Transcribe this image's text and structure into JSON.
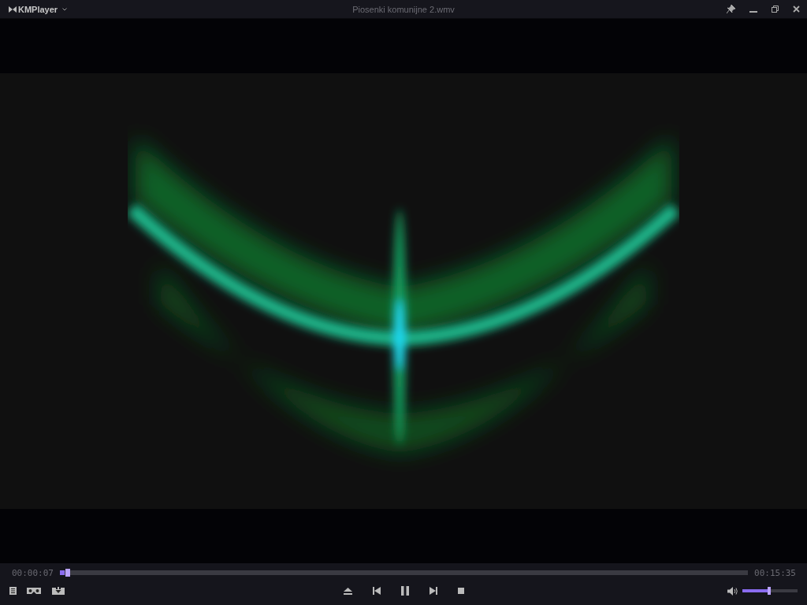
{
  "title_bar": {
    "app_name": "KMPlayer",
    "file_title": "Piosenki komunijne 2.wmv"
  },
  "seek": {
    "elapsed": "00:00:07",
    "level": 0.007,
    "total": "00:15:35"
  },
  "playback": {
    "playing": true
  },
  "volume": {
    "level": 0.49
  }
}
